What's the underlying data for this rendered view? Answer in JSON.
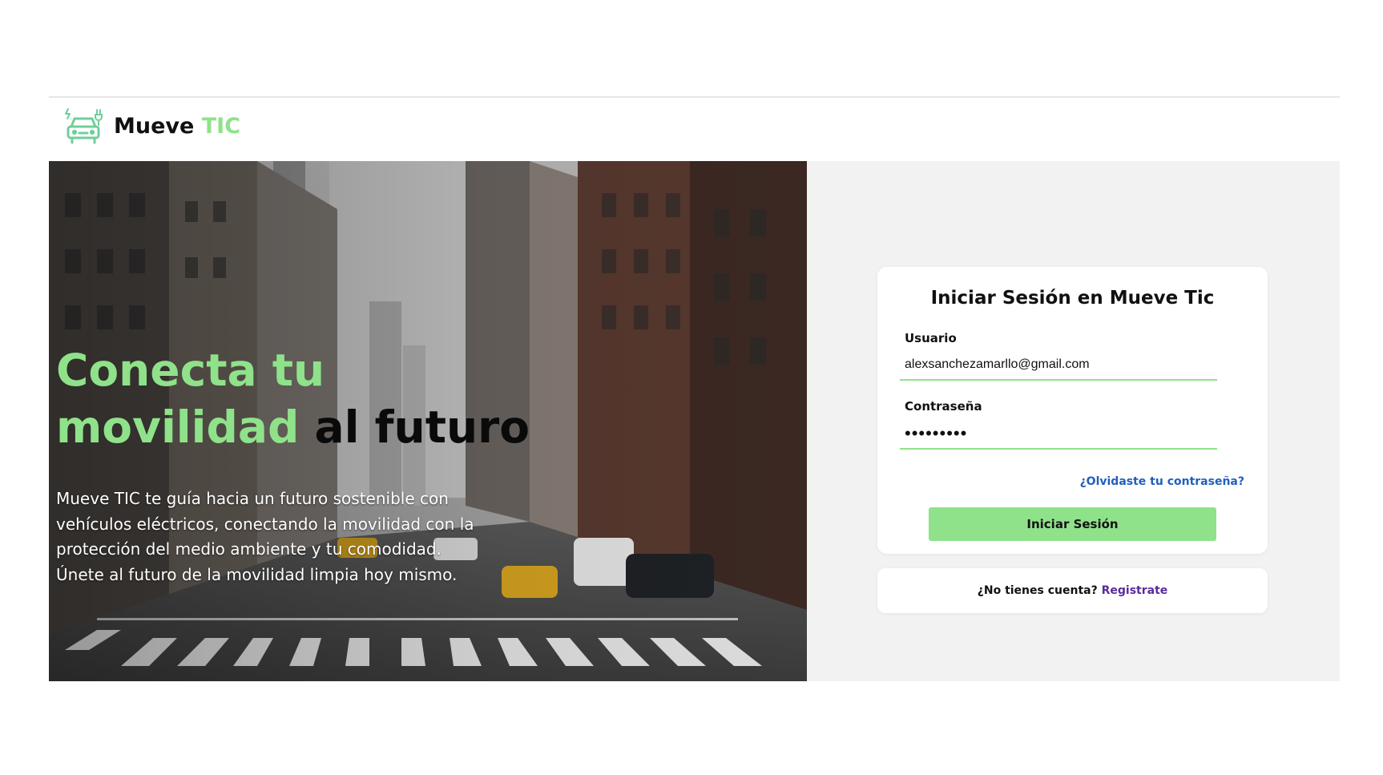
{
  "header": {
    "brand_primary": "Mueve",
    "brand_accent": "TIC",
    "logo_icon": "electric-car-icon"
  },
  "hero": {
    "title_line1": "Conecta tu",
    "title_line2_green": "movilidad",
    "title_line2_dark": "al futuro",
    "description": "Mueve TIC te guía hacia un futuro sostenible con vehículos eléctricos, conectando la movilidad con la protección del medio ambiente y tu comodidad. Únete al futuro de la movilidad limpia hoy mismo."
  },
  "login": {
    "title": "Iniciar Sesión en Mueve Tic",
    "username_label": "Usuario",
    "username_value": "alexsanchezamarllo@gmail.com",
    "password_label": "Contraseña",
    "password_value": "•••••••••",
    "forgot_link": "¿Olvidaste tu contraseña?",
    "submit_label": "Iniciar Sesión"
  },
  "register": {
    "prompt": "¿No tienes cuenta?",
    "link": "Registrate"
  },
  "colors": {
    "accent_green": "#8fe28a",
    "link_blue": "#1f5fbf",
    "link_purple": "#5b2a9e",
    "panel_gray": "#f2f2f2"
  }
}
